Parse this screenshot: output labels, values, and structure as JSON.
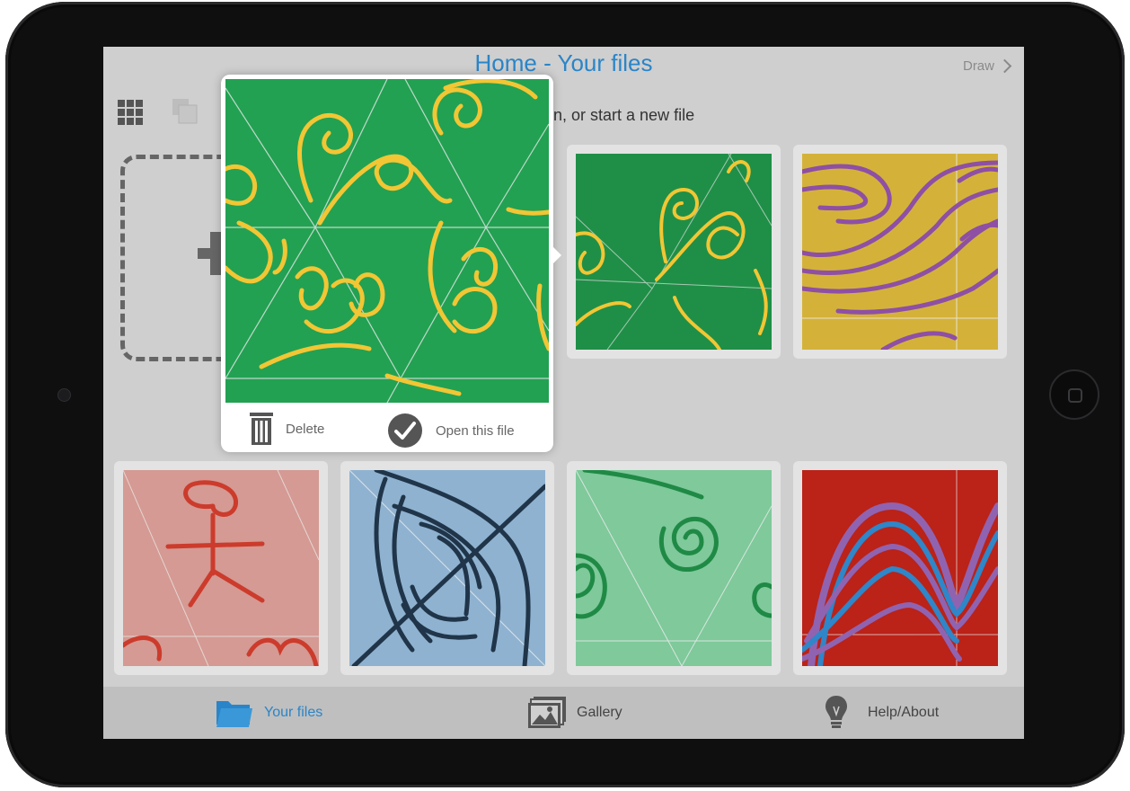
{
  "header": {
    "title": "Home - Your files",
    "draw_label": "Draw",
    "subtitle": "en, or start a new file"
  },
  "popover": {
    "delete_label": "Delete",
    "open_label": "Open this file"
  },
  "tabbar": {
    "tabs": [
      {
        "label": "Your files",
        "icon": "folder-icon",
        "active": true
      },
      {
        "label": "Gallery",
        "icon": "gallery-icon",
        "active": false
      },
      {
        "label": "Help/About",
        "icon": "lightbulb-icon",
        "active": false
      }
    ]
  },
  "colors": {
    "accent": "#2a85c8",
    "screen_bg": "#cfcfcf",
    "tabbar_bg": "#bfbfbf"
  },
  "tiles": [
    {
      "name": "green-swirls",
      "bg": "#1f8f47",
      "stroke": "#f2c634"
    },
    {
      "name": "gold-waves",
      "bg": "#d4b23a",
      "stroke": "#8e4fa5"
    },
    {
      "name": "pink-stick-figure",
      "bg": "#d49a93",
      "stroke": "#cc3b2c"
    },
    {
      "name": "blue-lines",
      "bg": "#8fb2d0",
      "stroke": "#203549"
    },
    {
      "name": "mint-spirals",
      "bg": "#7fc99b",
      "stroke": "#1f8a45"
    },
    {
      "name": "red-arches",
      "bg": "#bb2218",
      "stroke": "#9063b0"
    }
  ]
}
